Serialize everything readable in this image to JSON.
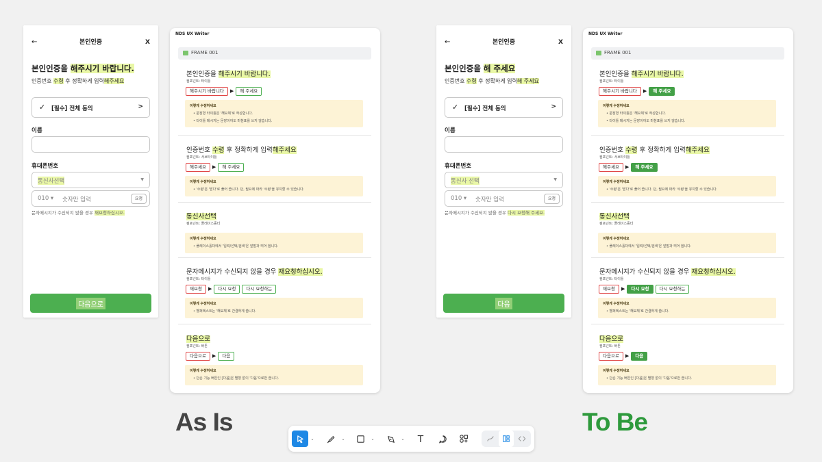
{
  "phone_asis": {
    "back": "←",
    "title": "본인인증",
    "close": "X",
    "headline_pre": "본인인증을 ",
    "headline_hl": "해주시기 바랍니다.",
    "sub_pre": "인증번호 ",
    "sub_hl1": "수령",
    "sub_mid": " 후 정확하게 입력",
    "sub_hl2": "해주세요",
    "agree_check": "✓",
    "agree_label": "[필수] 전체 동의",
    "agree_chevron": ">",
    "name_label": "이름",
    "phone_label": "휴대폰번호",
    "carrier_value": "통신사선택",
    "carrier_arrow": "▼",
    "prefix": "010 ▾",
    "number_placeholder": "숫자만 입력",
    "request_btn": "요청",
    "hint_pre": "문자메시지가 수신되지 않을 경우 ",
    "hint_hl": "재요청하십시오.",
    "next_btn": "다음으로"
  },
  "phone_tobe": {
    "back": "←",
    "title": "본인인증",
    "close": "X",
    "headline_pre": "본인인증을 ",
    "headline_hl": "해 주세요",
    "sub_pre": "인증번호 ",
    "sub_hl1": "수령",
    "sub_mid": " 후 정확하게 입력",
    "sub_hl2": "해 주세요",
    "agree_check": "✓",
    "agree_label": "[필수] 전체 동의",
    "agree_chevron": ">",
    "name_label": "이름",
    "phone_label": "휴대폰번호",
    "carrier_value": "통신사 선택",
    "carrier_arrow": "▼",
    "prefix": "010 ▾",
    "number_placeholder": "숫자만 입력",
    "request_btn": "요청",
    "hint_pre": "문자메시지가 수신되지 않을 경우 ",
    "hint_hl": "다시 요청해 주세요.",
    "next_btn": "다음"
  },
  "writer": {
    "app_title": "NDS UX Writer",
    "frame_label": "FRAME 001",
    "advice_title": "이렇게 수정하세요",
    "arrow": "▶",
    "sections": [
      {
        "head_pre": "본인인증을 ",
        "head_hl": "해주시기 바랍니다.",
        "head_post": "",
        "component": "컴포넌트: 타이틀",
        "chips": [
          {
            "text": "해주시기 바랍니다",
            "kind": "old"
          },
          {
            "text": "해 주세요",
            "kind": "new"
          }
        ],
        "advice": [
          "문장형 타이틀은 '해요체'로 작성합니다.",
          "타이틀 메시지는 문장이어도 마침표를 쓰지 않습니다."
        ]
      },
      {
        "head_pre": "인증번호 ",
        "head_hl": "수령",
        "head_mid": " 후 정확하게 입력",
        "head_hl2": "해주세요",
        "component": "컴포넌트: 서브타이틀",
        "chips": [
          {
            "text": "해주세요",
            "kind": "old"
          },
          {
            "text": "해 주세요",
            "kind": "new"
          }
        ],
        "advice": [
          "'수령'은 '받다'로 풀어 씁니다. 단, 필요에 따라 '수령'을 유지할 수 있습니다."
        ]
      },
      {
        "head_pre": "",
        "head_hl": "통신사선택",
        "head_post": "",
        "component": "컴포넌트: 플레이스홀더",
        "chips": [],
        "advice": [
          "플레이스홀더에서 '입력/선택/검색'은 앞말과 띄어 씁니다."
        ]
      },
      {
        "head_pre": "문자메시지가 수신되지 않을 경우 ",
        "head_hl": "재요청하십시오.",
        "head_post": "",
        "component": "컴포넌트: 타이틀",
        "chips": [
          {
            "text": "재요청",
            "kind": "old"
          },
          {
            "text": "다시 요청",
            "kind": "new"
          },
          {
            "text": "다시 요청하는",
            "kind": "new2"
          }
        ],
        "advice": [
          "헬퍼텍스트는 '해요체'로 간결하게 씁니다."
        ]
      },
      {
        "head_pre": "",
        "head_hl": "다음으로",
        "head_post": "",
        "component": "컴포넌트: 버튼",
        "chips": [
          {
            "text": "다음으로",
            "kind": "old"
          },
          {
            "text": "다음",
            "kind": "new"
          }
        ],
        "advice": [
          "단순 기능 버튼인 [다음]은 별형 없이 '다음'으로만 씁니다."
        ]
      }
    ]
  },
  "captions": {
    "as_is": "As Is",
    "to_be": "To Be"
  },
  "toolbar": {
    "icons": [
      "pointer-icon",
      "pen-icon",
      "rectangle-icon",
      "pen-tool-icon",
      "text-icon",
      "comment-icon",
      "components-icon",
      "draw-icon",
      "dev-mode-icon",
      "code-icon"
    ],
    "text_glyph": "T"
  },
  "colors": {
    "accent_green": "#4caf50",
    "highlight": "#e9f7a6",
    "tobe_caption": "#2e9a3c",
    "old_chip_border": "#e04545",
    "selected_tool": "#1e88e5"
  }
}
